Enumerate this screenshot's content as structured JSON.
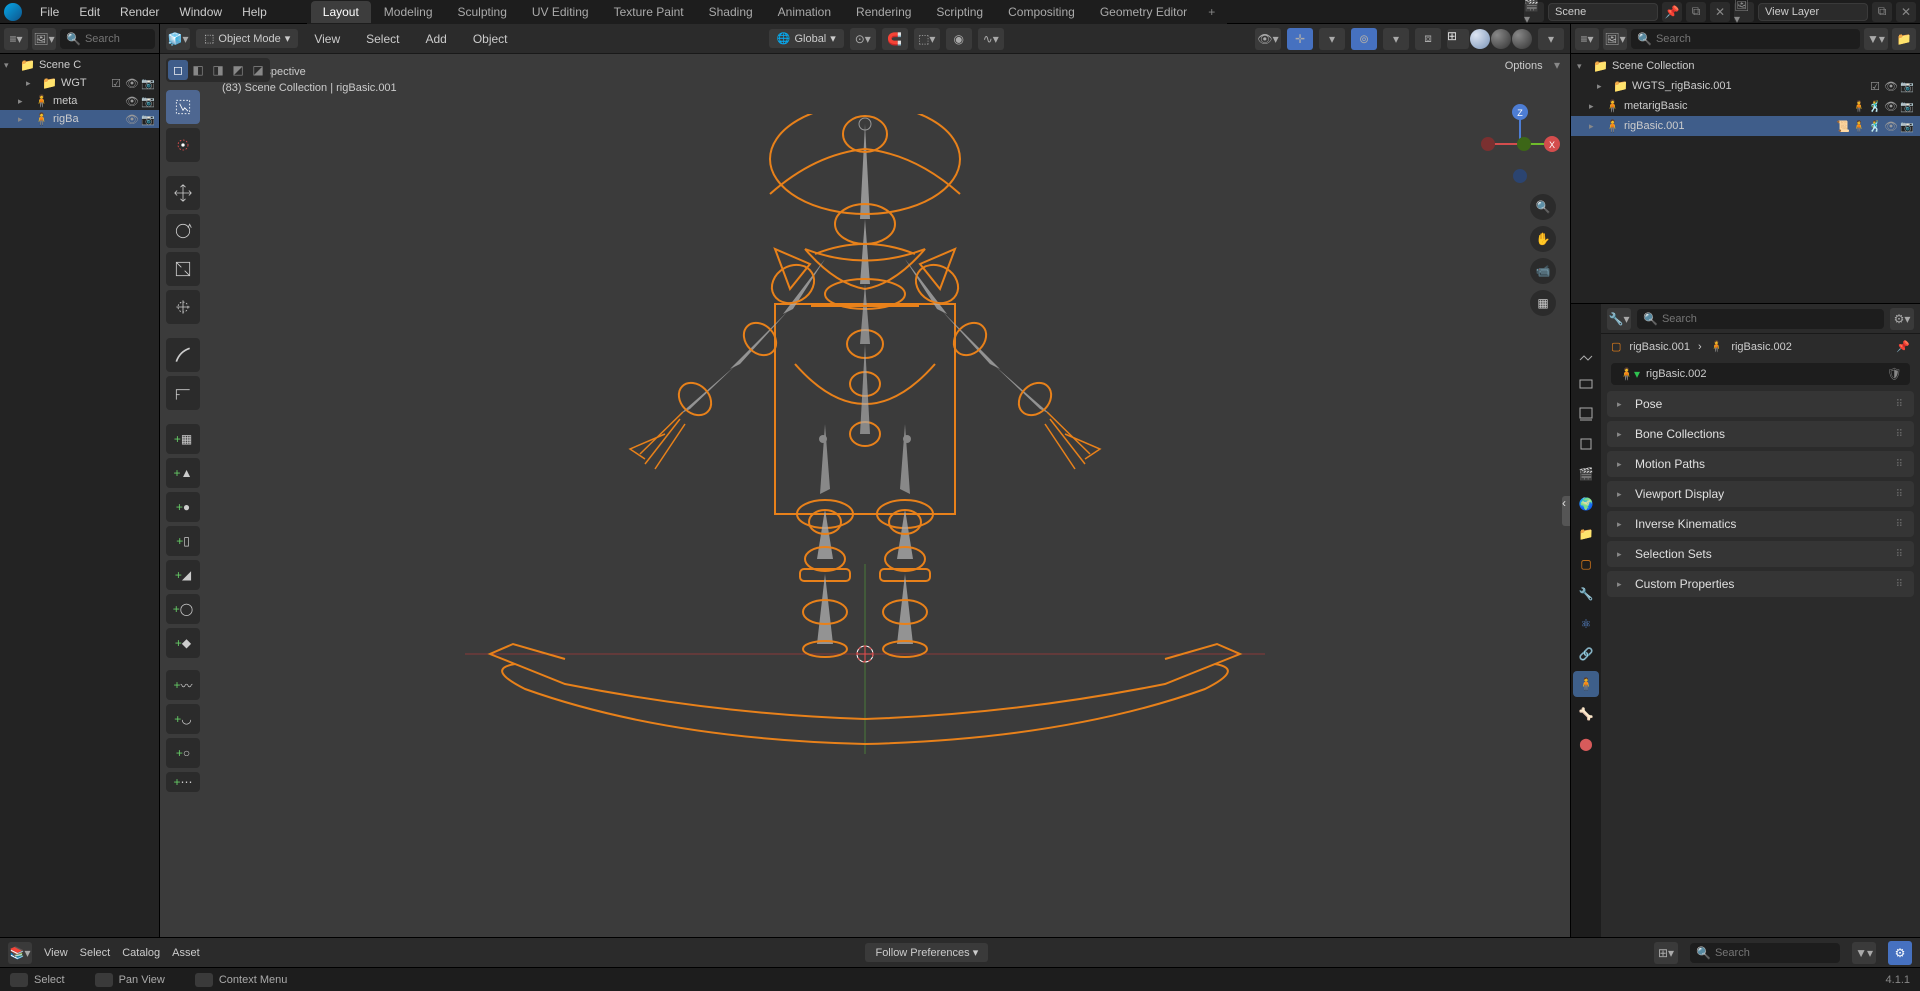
{
  "menu": {
    "file": "File",
    "edit": "Edit",
    "render": "Render",
    "window": "Window",
    "help": "Help"
  },
  "workspaces": {
    "tabs": [
      "Layout",
      "Modeling",
      "Sculpting",
      "UV Editing",
      "Texture Paint",
      "Shading",
      "Animation",
      "Rendering",
      "Scripting",
      "Compositing",
      "Geometry Editor"
    ],
    "active": "Layout"
  },
  "scene": {
    "name": "Scene",
    "viewlayer": "View Layer"
  },
  "left_outliner": {
    "root": "Scene C",
    "items": [
      {
        "label": "WGT",
        "icon": "collection"
      },
      {
        "label": "meta",
        "icon": "armature"
      },
      {
        "label": "rigBa",
        "icon": "armature",
        "selected": true
      }
    ]
  },
  "viewport": {
    "mode": "Object Mode",
    "menu": {
      "view": "View",
      "select": "Select",
      "add": "Add",
      "object": "Object"
    },
    "orientation": "Global",
    "options": "Options",
    "overlay": {
      "perspective": "User Perspective",
      "context": "(83) Scene Collection | rigBasic.001"
    }
  },
  "right_outliner": {
    "root": "Scene Collection",
    "items": [
      {
        "label": "WGTS_rigBasic.001",
        "icon": "collection"
      },
      {
        "label": "metarigBasic",
        "icon": "armature"
      },
      {
        "label": "rigBasic.001",
        "icon": "armature",
        "selected": true
      }
    ]
  },
  "properties": {
    "breadcrumb": {
      "a": "rigBasic.001",
      "b": "rigBasic.002"
    },
    "name": "rigBasic.002",
    "panels": [
      "Pose",
      "Bone Collections",
      "Motion Paths",
      "Viewport Display",
      "Inverse Kinematics",
      "Selection Sets",
      "Custom Properties"
    ]
  },
  "asset": {
    "menu": {
      "view": "View",
      "select": "Select",
      "catalog": "Catalog",
      "asset": "Asset"
    },
    "follow": "Follow Preferences"
  },
  "status": {
    "select": "Select",
    "pan": "Pan View",
    "context": "Context Menu",
    "version": "4.1.1"
  },
  "search": {
    "placeholder": "Search"
  }
}
